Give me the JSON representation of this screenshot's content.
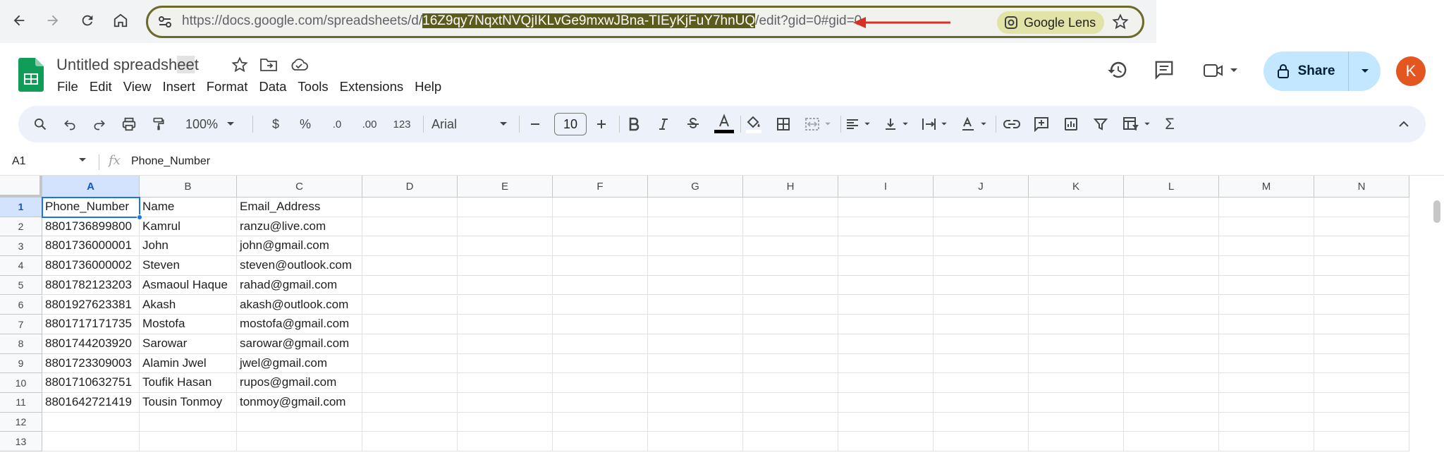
{
  "browser": {
    "url_prefix": "https://docs.google.com/spreadsheets/d/",
    "url_selected": "16Z9qy7NqxtNVQjIKLvGe9mxwJBna-TIEyKjFuY7hnUQ",
    "url_suffix": "/edit?gid=0#gid=0",
    "lens_label": "Google Lens",
    "accent_color": "#d93025"
  },
  "doc": {
    "title_main": "Untitled spreadsh",
    "title_highlight": "ee",
    "title_end": "t"
  },
  "menu": [
    "File",
    "Edit",
    "View",
    "Insert",
    "Format",
    "Data",
    "Tools",
    "Extensions",
    "Help"
  ],
  "header": {
    "share_label": "Share",
    "avatar_letter": "K"
  },
  "toolbar": {
    "zoom": "100%",
    "currency": "$",
    "percent": "%",
    "decrease_decimal": ".0",
    "increase_decimal": ".00",
    "number_format": "123",
    "font": "Arial",
    "font_size": "10",
    "sum": "Σ"
  },
  "formula_bar": {
    "name_box": "A1",
    "fx": "fx",
    "content": "Phone_Number"
  },
  "grid": {
    "columns": [
      "A",
      "B",
      "C",
      "D",
      "E",
      "F",
      "G",
      "H",
      "I",
      "J",
      "K",
      "L",
      "M",
      "N"
    ],
    "row_numbers": [
      "1",
      "2",
      "3",
      "4",
      "5",
      "6",
      "7",
      "8",
      "9",
      "10",
      "11",
      "12",
      "13"
    ],
    "rows": [
      [
        "Phone_Number",
        "Name",
        "Email_Address"
      ],
      [
        "8801736899800",
        "Kamrul",
        "ranzu@live.com"
      ],
      [
        "8801736000001",
        "John",
        "john@gmail.com"
      ],
      [
        "8801736000002",
        "Steven",
        "steven@outlook.com"
      ],
      [
        "8801782123203",
        "Asmaoul Haque",
        "rahad@gmail.com"
      ],
      [
        "8801927623381",
        "Akash",
        "akash@outlook.com"
      ],
      [
        "8801717171735",
        "Mostofa",
        "mostofa@gmail.com"
      ],
      [
        "8801744203920",
        "Sarowar",
        "sarowar@gmail.com"
      ],
      [
        "8801723309003",
        "Alamin Jwel",
        "jwel@gmail.com"
      ],
      [
        "8801710632751",
        "Toufik Hasan",
        "rupos@gmail.com"
      ],
      [
        "8801642721419",
        "Tousin Tonmoy",
        "tonmoy@gmail.com"
      ],
      [
        "",
        "",
        ""
      ],
      [
        "",
        "",
        ""
      ]
    ],
    "active_cell": "A1"
  }
}
